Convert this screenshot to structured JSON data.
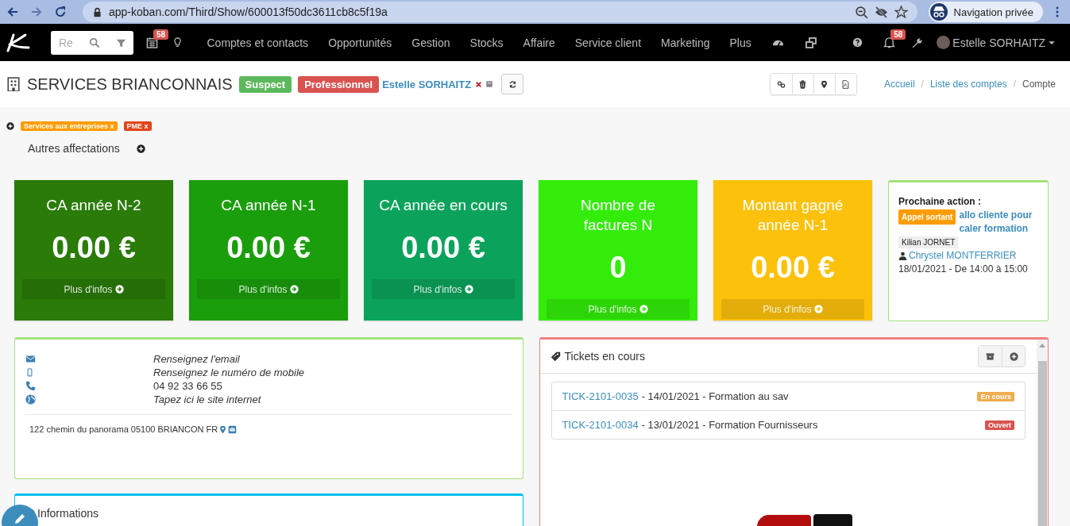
{
  "browser": {
    "url": "app-koban.com/Third/Show/600013f50dc3611cb8c5f19a",
    "profile": "Navigation privée"
  },
  "nav": {
    "search_placeholder": "Re",
    "calendar_badge": "58",
    "items": [
      "Comptes et contacts",
      "Opportunités",
      "Gestion",
      "Stocks",
      "Affaire",
      "Service client",
      "Marketing",
      "Plus"
    ],
    "notifications_badge": "58",
    "user": "Estelle SORHAITZ"
  },
  "header": {
    "title": "SERVICES BRIANCONNAIS",
    "badges": [
      {
        "label": "Suspect",
        "color": "#5cb85c"
      },
      {
        "label": "Professionnel",
        "color": "#d9534f"
      }
    ],
    "owner": "Estelle SORHAITZ",
    "separator": "/",
    "breadcrumb": [
      {
        "label": "Accueil",
        "kind": "link"
      },
      {
        "label": "Liste des comptes",
        "kind": "link"
      },
      {
        "label": "Compte",
        "kind": "current"
      }
    ]
  },
  "tags": [
    {
      "label": "Services aux entreprises x",
      "color": "#ff9c00"
    },
    {
      "label": "PME x",
      "color": "#e2451c"
    }
  ],
  "other_assignments": "Autres affectations",
  "kpis": [
    {
      "label": "CA année N-2",
      "value": "0.00 €",
      "link": "Plus d'infos",
      "color": "#2a7b08"
    },
    {
      "label": "CA année N-1",
      "value": "0.00 €",
      "link": "Plus d'infos",
      "color": "#1a9e0c"
    },
    {
      "label": "CA année en cours",
      "value": "0.00 €",
      "link": "Plus d'infos",
      "color": "#0ba35c"
    },
    {
      "label": "Nombre de factures N",
      "value": "0",
      "link": "Plus d'infos",
      "color": "#33ec0a"
    },
    {
      "label": "Montant gagné année N-1",
      "value": "0.00 €",
      "link": "Plus d'infos",
      "color": "#fcc10a"
    }
  ],
  "next_action": {
    "title": "Prochaine action :",
    "type": "Appel sortant",
    "subject": "allo cliente pour caler formation",
    "assignee": "Kilian JORNET",
    "contact": "Chrystel MONTFERRIER",
    "when": "18/01/2021 - De 14:00 à 15:00"
  },
  "contact": {
    "rows": [
      {
        "kind": "email",
        "text": "Renseignez l'email",
        "empty": true
      },
      {
        "kind": "mobile",
        "text": "Renseignez le numéro de mobile",
        "empty": true
      },
      {
        "kind": "phone",
        "text": "04 92 33 66 55",
        "empty": false
      },
      {
        "kind": "web",
        "text": "Tapez ici le site internet",
        "empty": true
      }
    ],
    "address": "122 chemin du panorama 05100 BRIANCON FR"
  },
  "tickets": {
    "title": "Tickets en cours",
    "items": [
      {
        "ref": "TICK-2101-0035",
        "details": "- 14/01/2021 - Formation au sav",
        "status": "En cours",
        "color": "#f0ad4e"
      },
      {
        "ref": "TICK-2101-0034",
        "details": "- 13/01/2021 - Formation Fournisseurs",
        "status": "Ouvert",
        "color": "#d9534f"
      }
    ]
  },
  "informations": {
    "title": "Informations"
  }
}
